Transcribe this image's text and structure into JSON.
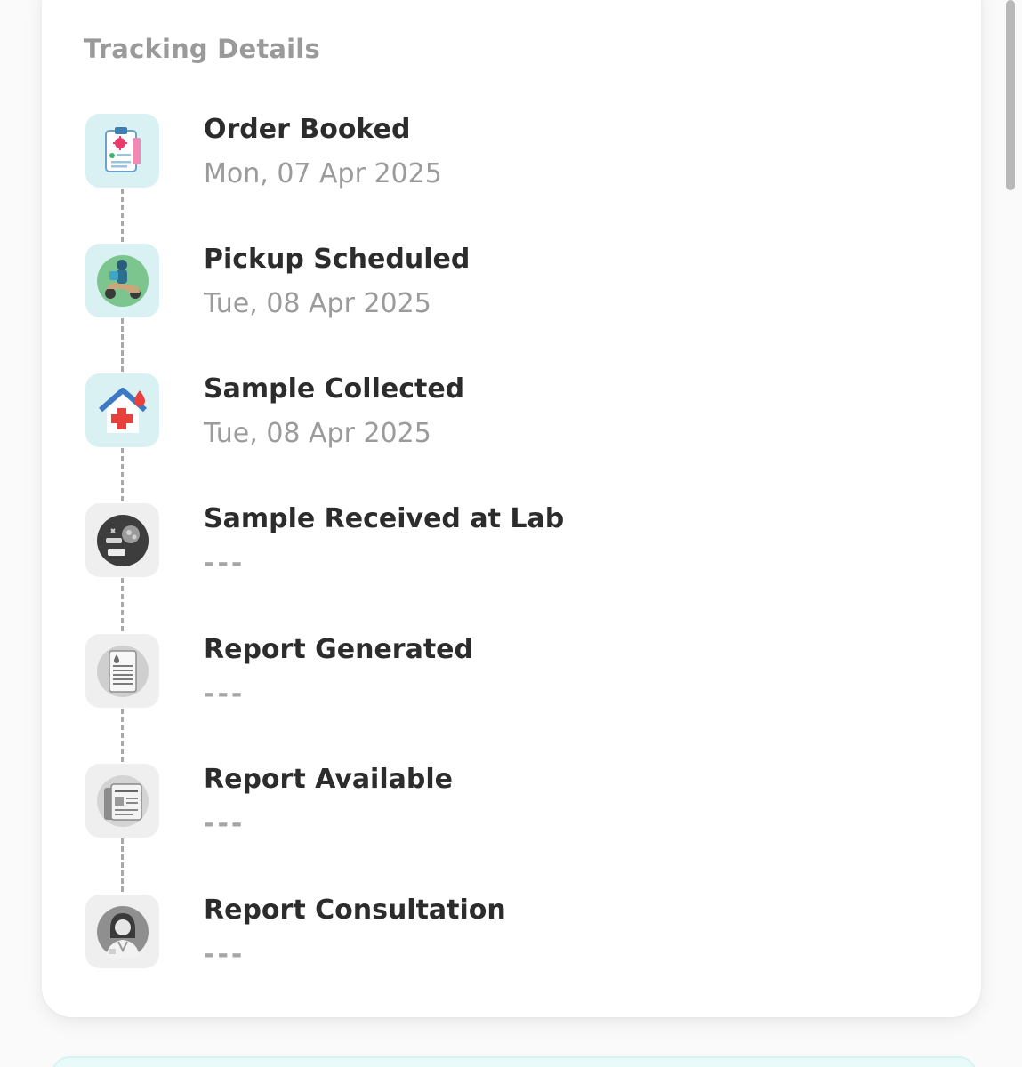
{
  "tracking": {
    "title": "Tracking Details",
    "steps": [
      {
        "label": "Order Booked",
        "date": "Mon, 07 Apr 2025",
        "status": "done",
        "icon": "clipboard-icon"
      },
      {
        "label": "Pickup Scheduled",
        "date": "Tue, 08 Apr 2025",
        "status": "done",
        "icon": "scooter-rider-icon"
      },
      {
        "label": "Sample Collected",
        "date": "Tue, 08 Apr 2025",
        "status": "done",
        "icon": "home-sample-icon"
      },
      {
        "label": "Sample Received at Lab",
        "date": "---",
        "status": "pending",
        "icon": "lab-icon"
      },
      {
        "label": "Report Generated",
        "date": "---",
        "status": "pending",
        "icon": "report-document-icon"
      },
      {
        "label": "Report Available",
        "date": "---",
        "status": "pending",
        "icon": "report-files-icon"
      },
      {
        "label": "Report Consultation",
        "date": "---",
        "status": "pending",
        "icon": "doctor-icon"
      }
    ]
  },
  "colors": {
    "active_icon_bg": "#d9f1f3",
    "pending_icon_bg": "#efefef",
    "title": "#2c2c2c",
    "muted": "#9b9b9b"
  }
}
